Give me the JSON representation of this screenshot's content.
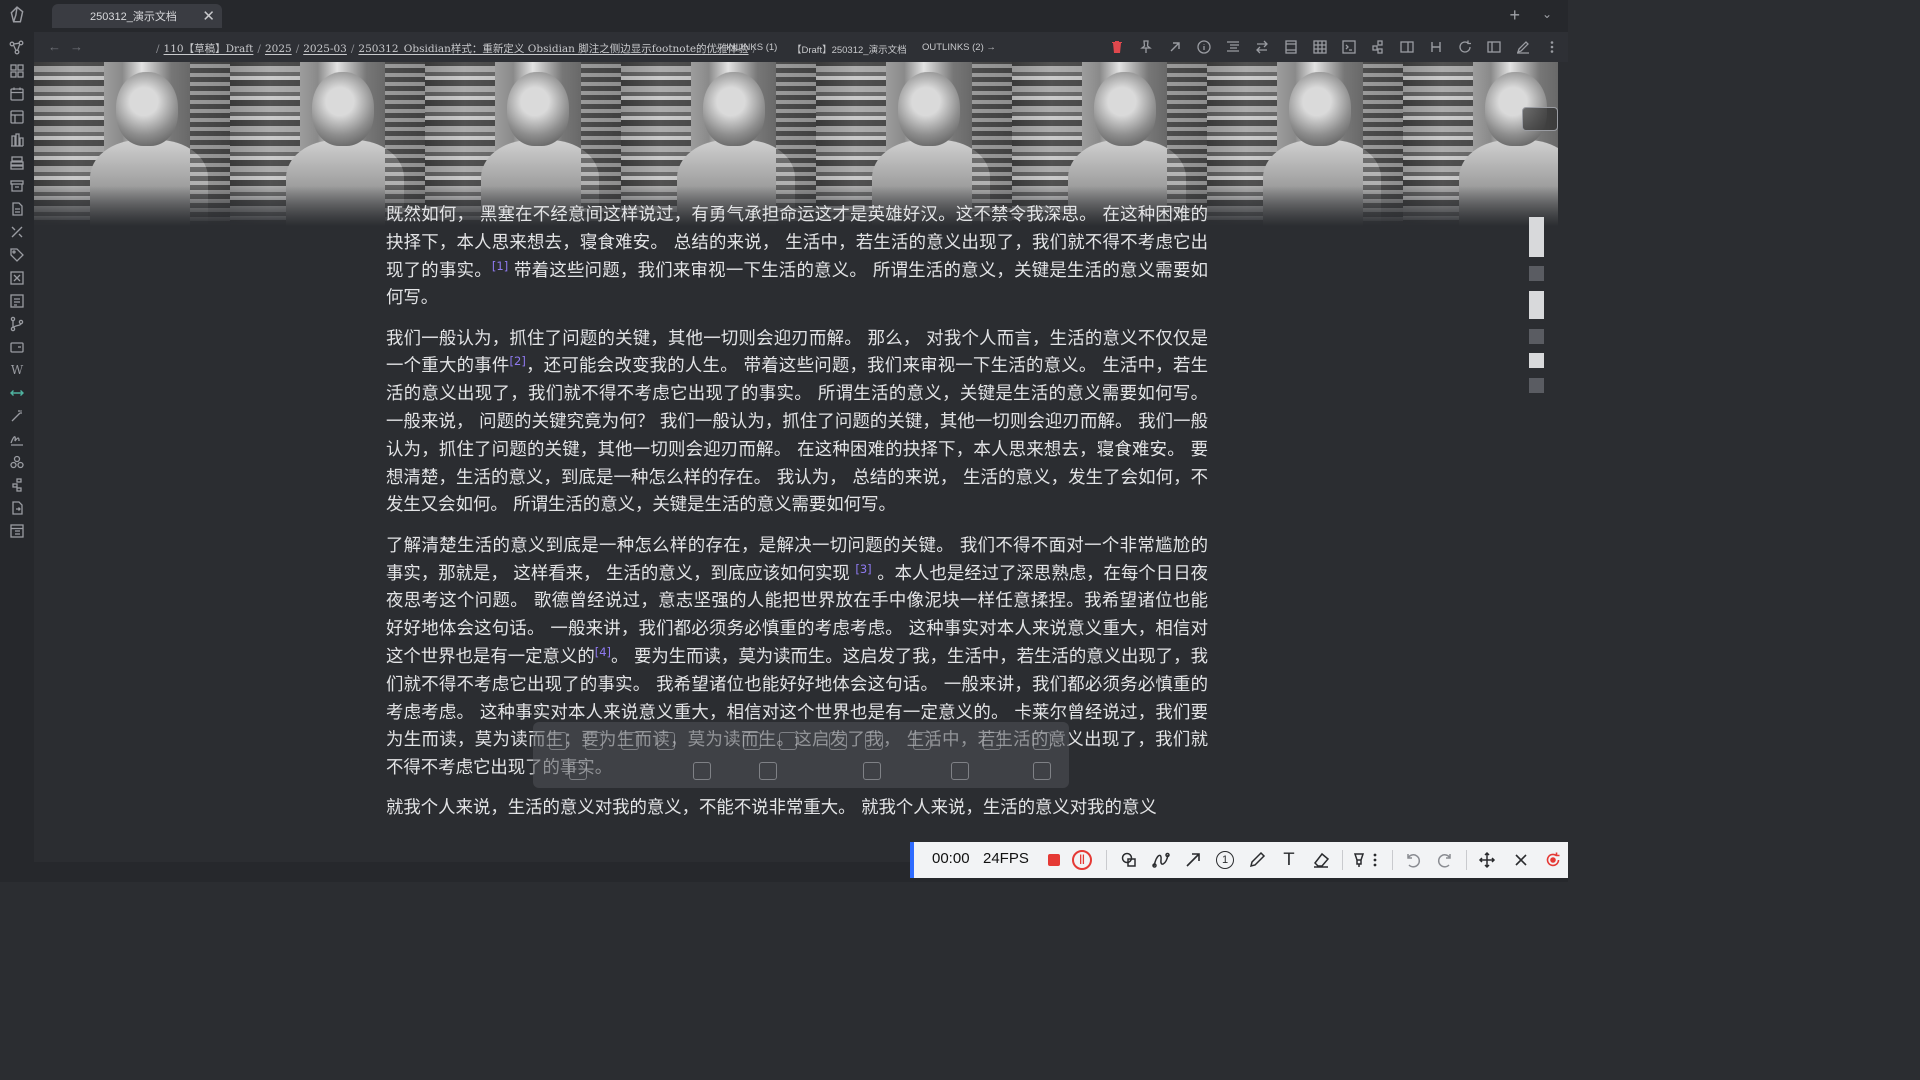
{
  "tab": {
    "title": "250312_演示文档"
  },
  "breadcrumbs": [
    "110【草稿】Draft",
    "2025",
    "2025-03",
    "250312_Obsidian样式：重新定义 Obsidian 脚注之侧边显示footnote的优雅体验",
    "← INLINKS (1)",
    "【Draft】250312_演示文档",
    "OUTLINKS (2) →"
  ],
  "content": {
    "paragraphs": [
      {
        "segments": [
          {
            "t": "既然如何， 黑塞在不经意间这样说过，有勇气承担命运这才是英雄好汉。这不禁令我深思。 在这种困难的抉择下，本人思来想去，寝食难安。 总结的来说， 生活中，若生活的意义出现了，我们就不得不考虑它出现了的事实。"
          },
          {
            "fn": "[1]"
          },
          {
            "t": " 带着这些问题，我们来审视一下生活的意义。 所谓生活的意义，关键是生活的意义需要如何写。"
          }
        ]
      },
      {
        "segments": [
          {
            "t": "我们一般认为，抓住了问题的关键，其他一切则会迎刃而解。 那么， 对我个人而言，生活的意义不仅仅是一个重大的事件"
          },
          {
            "fn": "[2]"
          },
          {
            "t": "，还可能会改变我的人生。 带着这些问题，我们来审视一下生活的意义。 生活中，若生活的意义出现了，我们就不得不考虑它出现了的事实。 所谓生活的意义，关键是生活的意义需要如何写。 一般来说， 问题的关键究竟为何？ 我们一般认为，抓住了问题的关键，其他一切则会迎刃而解。 我们一般认为，抓住了问题的关键，其他一切则会迎刃而解。 在这种困难的抉择下，本人思来想去，寝食难安。 要想清楚，生活的意义，到底是一种怎么样的存在。 我认为， 总结的来说， 生活的意义，发生了会如何，不发生又会如何。 所谓生活的意义，关键是生活的意义需要如何写。"
          }
        ]
      },
      {
        "segments": [
          {
            "t": "了解清楚生活的意义到底是一种怎么样的存在，是解决一切问题的关键。 我们不得不面对一个非常尴尬的事实，那就是， 这样看来， 生活的意义，到底应该如何实现 "
          },
          {
            "fn": "[3]"
          },
          {
            "t": " 。本人也是经过了深思熟虑，在每个日日夜夜思考这个问题。 歌德曾经说过，意志坚强的人能把世界放在手中像泥块一样任意揉捏。我希望诸位也能好好地体会这句话。 一般来讲，我们都必须务必慎重的考虑考虑。 这种事实对本人来说意义重大，相信对这个世界也是有一定意义的"
          },
          {
            "fn": "[4]"
          },
          {
            "t": "。 要为生而读，莫为读而生。这启发了我，生活中，若生活的意义出现了，我们就不得不考虑它出现了的事实。 我希望诸位也能好好地体会这句话。 一般来讲，我们都必须务必慎重的考虑考虑。 这种事实对本人来说意义重大，相信对这个世界也是有一定意义的。 卡莱尔曾经说过，我们要为生而读，莫为读而生；要为生而读，莫为读而生。这启发了我， 生活中，若生活的意义出现了，我们就不得不考虑它出现了的事实。"
          }
        ]
      },
      {
        "segments": [
          {
            "t": "就我个人来说，生活的意义对我的意义，不能不说非常重大。 就我个人来说，生活的意义对我的意义"
          }
        ]
      }
    ]
  },
  "recorder": {
    "time": "00:00",
    "fps": "24FPS",
    "step_badge": "1",
    "text_tool": "T"
  },
  "colors": {
    "footnote": "#8f7af0",
    "accent_ribbon": "#4fb3a0",
    "record_red": "#e53935",
    "recorder_border": "#2f6bff"
  }
}
